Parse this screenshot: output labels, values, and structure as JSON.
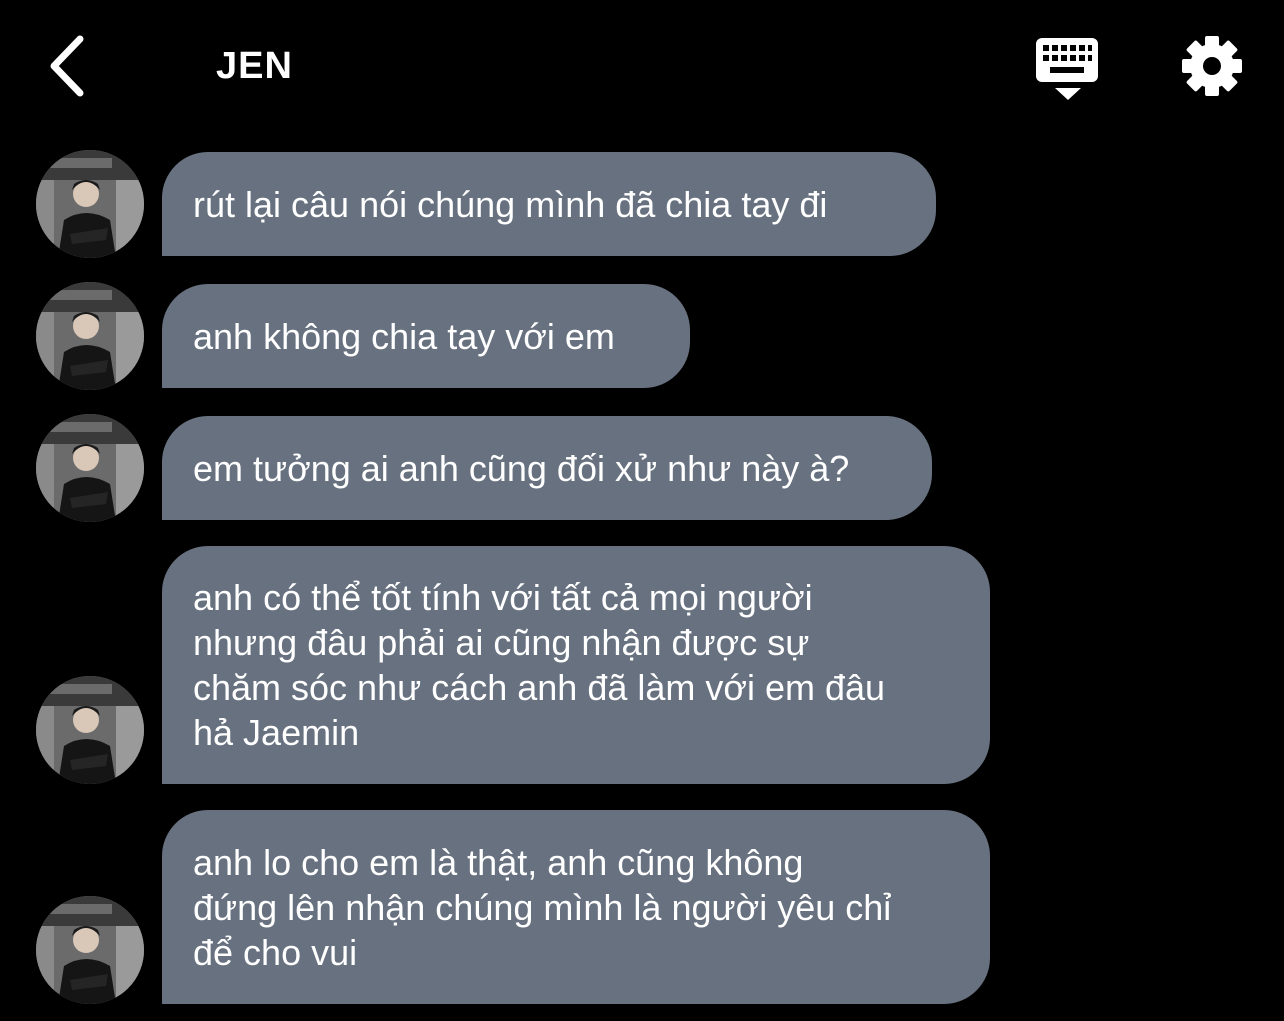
{
  "header": {
    "title": "JEN",
    "back_icon": "chevron-left-icon",
    "keyboard_icon": "keyboard-icon",
    "settings_icon": "gear-icon"
  },
  "colors": {
    "background": "#000000",
    "bubble": "#67717f",
    "text": "#ffffff"
  },
  "messages": [
    {
      "text": "rút lại câu nói chúng mình đã chia tay đi"
    },
    {
      "text": "anh không chia tay với em"
    },
    {
      "text": "em tưởng ai anh cũng đối xử như này à?"
    },
    {
      "text": "anh có thể tốt tính với tất cả mọi người\nnhưng đâu phải ai cũng nhận được sự\nchăm sóc như cách anh đã làm với em đâu\nhả Jaemin"
    },
    {
      "text": "anh lo cho em là thật, anh cũng không\nđứng lên nhận chúng mình là người yêu chỉ\nđể cho vui"
    }
  ]
}
